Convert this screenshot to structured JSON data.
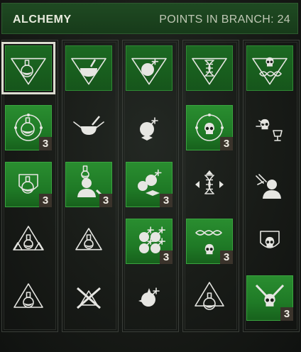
{
  "header": {
    "title": "ALCHEMY",
    "points_label": "POINTS IN BRANCH: 24"
  },
  "colors": {
    "unlocked": "#2a8e30",
    "locked": "#1c1f1b",
    "icon": "#e6e6e2",
    "badge_bg": "#3a332b",
    "header_bg": "#1f4a22"
  },
  "grid": {
    "columns": [
      {
        "header_icon": "potion-flask-icon",
        "skills": [
          {
            "icon": "potion-ring-icon",
            "unlocked": true,
            "level": "3"
          },
          {
            "icon": "potion-shield-icon",
            "unlocked": true,
            "level": "3"
          },
          {
            "icon": "potion-triangle-icon",
            "unlocked": false,
            "level": ""
          },
          {
            "icon": "potion-drop-icon",
            "unlocked": false,
            "level": ""
          }
        ]
      },
      {
        "header_icon": "mortar-icon",
        "skills": [
          {
            "icon": "mortar-pestle-icon",
            "unlocked": false,
            "level": ""
          },
          {
            "icon": "mutagen-bust-icon",
            "unlocked": true,
            "level": "3"
          },
          {
            "icon": "potion-triangle-small-icon",
            "unlocked": false,
            "level": ""
          },
          {
            "icon": "crossed-blades-icon",
            "unlocked": false,
            "level": ""
          }
        ]
      },
      {
        "header_icon": "bomb-icon",
        "skills": [
          {
            "icon": "bomb-spark-icon",
            "unlocked": false,
            "level": ""
          },
          {
            "icon": "bomb-cluster-icon",
            "unlocked": true,
            "level": "3"
          },
          {
            "icon": "bomb-multi-icon",
            "unlocked": true,
            "level": "3"
          },
          {
            "icon": "bomb-star-icon",
            "unlocked": false,
            "level": ""
          }
        ]
      },
      {
        "header_icon": "dna-icon",
        "skills": [
          {
            "icon": "skull-ring-icon",
            "unlocked": true,
            "level": "3"
          },
          {
            "icon": "dna-arrows-icon",
            "unlocked": false,
            "level": ""
          },
          {
            "icon": "dna-skull-icon",
            "unlocked": true,
            "level": "3"
          },
          {
            "icon": "flask-triangle-icon",
            "unlocked": false,
            "level": ""
          }
        ]
      },
      {
        "header_icon": "skull-dna-icon",
        "skills": [
          {
            "icon": "skull-goblet-icon",
            "unlocked": false,
            "level": ""
          },
          {
            "icon": "bust-arrows-icon",
            "unlocked": false,
            "level": ""
          },
          {
            "icon": "skull-shield-icon",
            "unlocked": false,
            "level": ""
          },
          {
            "icon": "skull-swords-icon",
            "unlocked": true,
            "level": "3"
          }
        ]
      }
    ]
  }
}
